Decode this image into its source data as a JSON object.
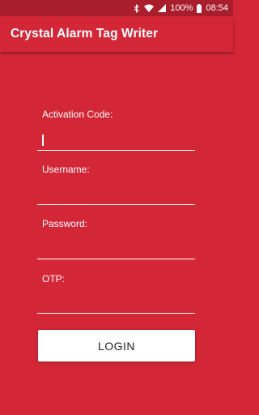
{
  "status_bar": {
    "battery": "100%",
    "time": "08:54",
    "icons": [
      "bluetooth-icon",
      "wifi-icon",
      "signal-icon",
      "battery-icon"
    ]
  },
  "app_bar": {
    "title": "Crystal Alarm Tag Writer"
  },
  "form": {
    "activation_code": {
      "label": "Activation Code:",
      "value": ""
    },
    "username": {
      "label": "Username:",
      "value": ""
    },
    "password": {
      "label": "Password:",
      "value": ""
    },
    "otp": {
      "label": "OTP:",
      "value": ""
    },
    "login_label": "LOGIN"
  },
  "colors": {
    "primary": "#D32737",
    "primary_dark": "#A81E2C",
    "button_bg": "#ffffff"
  }
}
